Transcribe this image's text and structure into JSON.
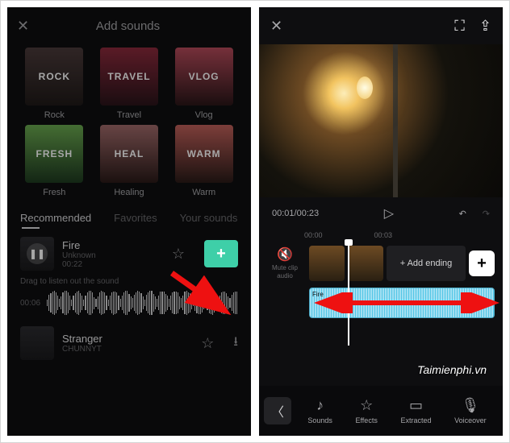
{
  "left": {
    "header": {
      "title": "Add sounds"
    },
    "categories": [
      {
        "name": "ROCK",
        "label": "Rock"
      },
      {
        "name": "TRAVEL",
        "label": "Travel"
      },
      {
        "name": "VLOG",
        "label": "Vlog"
      },
      {
        "name": "FRESH",
        "label": "Fresh"
      },
      {
        "name": "HEAL",
        "label": "Healing"
      },
      {
        "name": "WARM",
        "label": "Warm"
      }
    ],
    "tabs": [
      {
        "label": "Recommended",
        "active": true
      },
      {
        "label": "Favorites",
        "active": false
      },
      {
        "label": "Your sounds",
        "active": false
      }
    ],
    "songs": [
      {
        "title": "Fire",
        "artist": "Unknown",
        "duration": "00:22"
      },
      {
        "title": "Stranger",
        "artist": "CHUNNYT",
        "duration": ""
      }
    ],
    "drag_hint": "Drag to listen out the sound",
    "wave_time": "00:06"
  },
  "right": {
    "timecode": "00:01/00:23",
    "ruler": [
      "00:00",
      "00:03"
    ],
    "mute_label": "Mute clip audio",
    "audio_clip_label": "Fire",
    "add_ending_label": "+ Add ending",
    "tools": [
      {
        "icon": "♪",
        "label": "Sounds"
      },
      {
        "icon": "☆",
        "label": "Effects"
      },
      {
        "icon": "▭",
        "label": "Extracted"
      },
      {
        "icon": "🎙",
        "label": "Voiceover"
      }
    ]
  },
  "watermark": "Taimienphi.vn"
}
